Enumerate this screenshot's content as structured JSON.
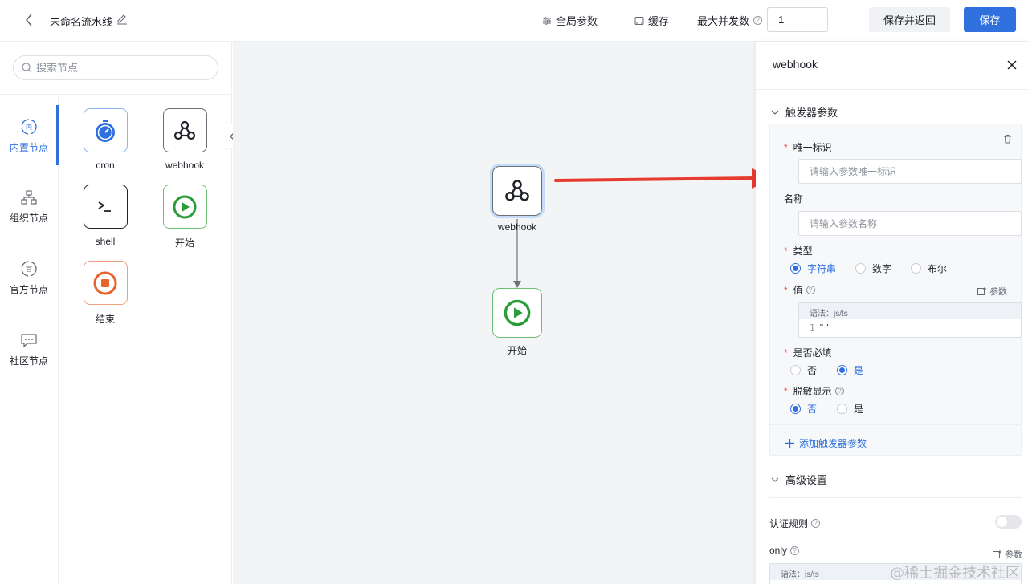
{
  "header": {
    "title": "未命名流水线",
    "global_params": "全局参数",
    "cache": "缓存",
    "max_concurrency_label": "最大并发数",
    "max_concurrency_value": "1",
    "save_return": "保存并返回",
    "save": "保存"
  },
  "left_panel": {
    "search_placeholder": "搜索节点",
    "categories": [
      {
        "label": "内置节点",
        "icon": "builtin-icon",
        "active": true
      },
      {
        "label": "组织节点",
        "icon": "org-icon",
        "active": false
      },
      {
        "label": "官方节点",
        "icon": "official-icon",
        "active": false
      },
      {
        "label": "社区节点",
        "icon": "community-icon",
        "active": false
      }
    ],
    "nodes": [
      {
        "label": "cron",
        "icon": "stopwatch-icon"
      },
      {
        "label": "webhook",
        "icon": "webhook-icon"
      },
      {
        "label": "shell",
        "icon": "terminal-icon"
      },
      {
        "label": "开始",
        "icon": "play-icon"
      },
      {
        "label": "结束",
        "icon": "stop-icon"
      }
    ]
  },
  "canvas": {
    "nodes": [
      {
        "label": "webhook",
        "icon": "webhook-icon",
        "selected": true
      },
      {
        "label": "开始",
        "icon": "play-icon",
        "selected": false
      }
    ]
  },
  "right_panel": {
    "title": "webhook",
    "trigger_section": "触发器参数",
    "fields": {
      "unique_id_label": "唯一标识",
      "unique_id_placeholder": "请输入参数唯一标识",
      "name_label": "名称",
      "name_placeholder": "请输入参数名称",
      "type_label": "类型",
      "type_options": [
        "字符串",
        "数字",
        "布尔"
      ],
      "type_selected": "字符串",
      "value_label": "值",
      "param_link": "参数",
      "code_syntax": "语法：js/ts",
      "code_line_number": "1",
      "code_value": "\"\"",
      "required_label": "是否必填",
      "required_options": [
        "否",
        "是"
      ],
      "required_selected": "是",
      "mask_label": "脱敏显示",
      "mask_options": [
        "否",
        "是"
      ],
      "mask_selected": "否"
    },
    "add_trigger_param": "添加触发器参数",
    "advanced_section": "高级设置",
    "auth_rule_label": "认证规则",
    "auth_rule_enabled": false,
    "only_label": "only",
    "only_param_link": "参数",
    "only_code_syntax": "语法：js/ts"
  },
  "watermark": "@稀土掘金技术社区",
  "colors": {
    "primary": "#2f6fde",
    "cron": "#2f6fde",
    "start": "#2a9d3a",
    "end": "#e8622c",
    "arrow": "#e63b2e",
    "required": "#f54a45"
  }
}
